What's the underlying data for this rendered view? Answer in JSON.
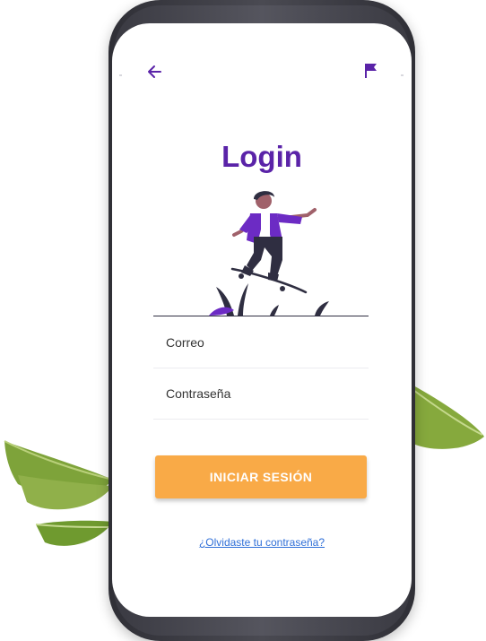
{
  "header": {
    "back_icon": "arrow-left-icon",
    "flag_icon": "flag-icon"
  },
  "title": "Login",
  "form": {
    "email_placeholder": "Correo",
    "password_placeholder": "Contraseña",
    "submit_label": "INICIAR SESIÓN"
  },
  "forgot_password_label": "¿Olvidaste tu contraseña?",
  "colors": {
    "primary": "#5a23a8",
    "accent": "#f9aa47",
    "link": "#2f6fd8"
  }
}
